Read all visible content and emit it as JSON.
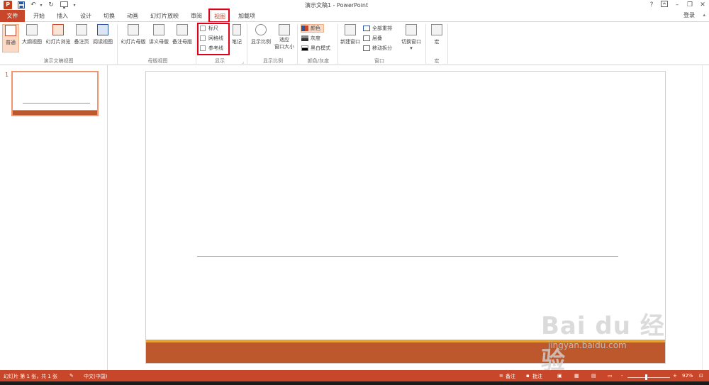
{
  "window": {
    "title": "演示文稿1 - PowerPoint",
    "logo": "P",
    "help": "?",
    "login": "登录"
  },
  "tabs": [
    "文件",
    "开始",
    "插入",
    "设计",
    "切换",
    "动画",
    "幻灯片放映",
    "审阅",
    "视图",
    "加载项"
  ],
  "active_tab": "视图",
  "ribbon": {
    "presentation_views": {
      "group": "演示文稿视图",
      "buttons": [
        "普通",
        "大纲视图",
        "幻灯片浏览",
        "备注页",
        "阅读视图"
      ]
    },
    "master_views": {
      "group": "母版视图",
      "buttons": [
        "幻灯片母版",
        "讲义母版",
        "备注母版"
      ]
    },
    "show": {
      "group": "显示",
      "checkboxes": [
        "标尺",
        "网格线",
        "参考线"
      ],
      "notes_button": "笔记"
    },
    "zoom": {
      "group": "显示比例",
      "zoom_button": "显示比例",
      "fit_button_line1": "适应",
      "fit_button_line2": "窗口大小"
    },
    "color": {
      "group": "颜色/灰度",
      "options": [
        "颜色",
        "灰度",
        "黑白模式"
      ]
    },
    "window": {
      "group": "窗口",
      "new_window": "新建窗口",
      "arrange_all": "全部重排",
      "cascade": "层叠",
      "move_split": "移动拆分",
      "switch_windows": "切换窗口"
    },
    "macros": {
      "group": "宏",
      "button": "宏"
    }
  },
  "slides": {
    "current_number": "1"
  },
  "watermark": {
    "main": "Bai du 经验",
    "sub": "jingyan.baidu.com"
  },
  "statusbar": {
    "slide_info": "幻灯片 第 1 张，共 1 张",
    "language": "中文(中国)",
    "notes": "备注",
    "comments": "批注",
    "zoom_level": "92%",
    "zoom_out": "-",
    "zoom_in": "+"
  },
  "colors": {
    "accent": "#c8462a",
    "slide_band": "#bd582c",
    "slide_band_top": "#e8a135",
    "highlight_box": "#e0001a"
  }
}
